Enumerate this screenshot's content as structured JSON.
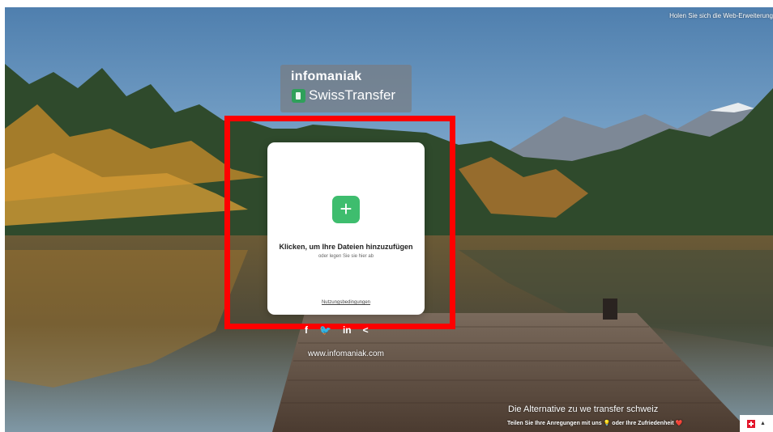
{
  "header": {
    "extension_link": "Holen Sie sich die Web-Erweiterung"
  },
  "brand": {
    "company": "infomaniak",
    "product": "SwissTransfer",
    "logo_icon": "swisstransfer-logo-icon"
  },
  "upload": {
    "add_icon": "+",
    "title": "Klicken, um Ihre Dateien hinzuzufügen",
    "subtitle": "oder legen Sie sie hier ab",
    "terms": "Nutzungsbedingungen"
  },
  "social": {
    "facebook": "f",
    "twitter": "🐦",
    "linkedin": "in",
    "share": "<"
  },
  "footer": {
    "website": "www.infomaniak.com",
    "tagline": "Die Alternative zu we transfer schweiz",
    "feedback": "Teilen Sie Ihre Anregungen mit uns 💡 oder Ihre Zufriedenheit ❤️"
  },
  "colors": {
    "accent": "#3ebd6e",
    "highlight": "#ff0000",
    "flag": "#e3162b"
  }
}
